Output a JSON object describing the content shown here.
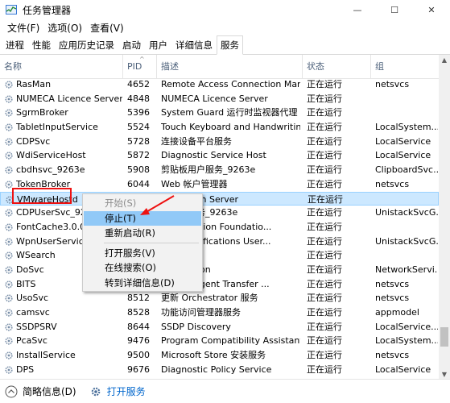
{
  "window": {
    "title": "任务管理器",
    "controls": [
      "—",
      "☐",
      "✕"
    ]
  },
  "menu": [
    "文件(F)",
    "选项(O)",
    "查看(V)"
  ],
  "tabs": [
    {
      "label": "进程",
      "active": false
    },
    {
      "label": "性能",
      "active": false
    },
    {
      "label": "应用历史记录",
      "active": false
    },
    {
      "label": "启动",
      "active": false
    },
    {
      "label": "用户",
      "active": false
    },
    {
      "label": "详细信息",
      "active": false
    },
    {
      "label": "服务",
      "active": true
    }
  ],
  "columns": {
    "name": "名称",
    "pid": "PID",
    "desc": "描述",
    "status": "状态",
    "group": "组"
  },
  "rows": [
    {
      "name": "RasMan",
      "pid": "4652",
      "desc": "Remote Access Connection Man...",
      "status": "正在运行",
      "group": "netsvcs"
    },
    {
      "name": "NUMECA Licence Server",
      "pid": "4848",
      "desc": "NUMECA Licence Server",
      "status": "正在运行",
      "group": ""
    },
    {
      "name": "SgrmBroker",
      "pid": "5396",
      "desc": "System Guard 运行时监视器代理",
      "status": "正在运行",
      "group": ""
    },
    {
      "name": "TabletInputService",
      "pid": "5524",
      "desc": "Touch Keyboard and Handwritin...",
      "status": "正在运行",
      "group": "LocalSystem..."
    },
    {
      "name": "CDPSvc",
      "pid": "5728",
      "desc": "连接设备平台服务",
      "status": "正在运行",
      "group": "LocalService"
    },
    {
      "name": "WdiServiceHost",
      "pid": "5872",
      "desc": "Diagnostic Service Host",
      "status": "正在运行",
      "group": "LocalService"
    },
    {
      "name": "cbdhsvc_9263e",
      "pid": "5908",
      "desc": "剪贴板用户服务_9263e",
      "status": "正在运行",
      "group": "ClipboardSvc..."
    },
    {
      "name": "TokenBroker",
      "pid": "6044",
      "desc": "Web 帐户管理器",
      "status": "正在运行",
      "group": "netsvcs"
    },
    {
      "name": "VMwareHostd",
      "pid": "",
      "desc": "orkstation Server",
      "status": "正在运行",
      "group": ""
    },
    {
      "name": "CDPUserSvc_926",
      "pid": "",
      "desc": "台用户服务_9263e",
      "status": "正在运行",
      "group": "UnistackSvcG..."
    },
    {
      "name": "FontCache3.0.0.0",
      "pid": "",
      "desc": "Presentation Foundatio...",
      "status": "正在运行",
      "group": ""
    },
    {
      "name": "WpnUserService",
      "pid": "",
      "desc": "Push Notifications User...",
      "status": "正在运行",
      "group": "UnistackSvcG..."
    },
    {
      "name": "WSearch",
      "pid": "",
      "desc": "",
      "status": "正在运行",
      "group": ""
    },
    {
      "name": "DoSvc",
      "pid": "",
      "desc": "ptimization",
      "status": "正在运行",
      "group": "NetworkServi..."
    },
    {
      "name": "BITS",
      "pid": "",
      "desc": "nd Intelligent Transfer ...",
      "status": "正在运行",
      "group": "netsvcs"
    },
    {
      "name": "UsoSvc",
      "pid": "8512",
      "desc": "更新 Orchestrator 服务",
      "status": "正在运行",
      "group": "netsvcs"
    },
    {
      "name": "camsvc",
      "pid": "8528",
      "desc": "功能访问管理器服务",
      "status": "正在运行",
      "group": "appmodel"
    },
    {
      "name": "SSDPSRV",
      "pid": "8644",
      "desc": "SSDP Discovery",
      "status": "正在运行",
      "group": "LocalService..."
    },
    {
      "name": "PcaSvc",
      "pid": "9476",
      "desc": "Program Compatibility Assistant ...",
      "status": "正在运行",
      "group": "LocalSystem..."
    },
    {
      "name": "InstallService",
      "pid": "9500",
      "desc": "Microsoft Store 安装服务",
      "status": "正在运行",
      "group": "netsvcs"
    },
    {
      "name": "DPS",
      "pid": "9676",
      "desc": "Diagnostic Policy Service",
      "status": "正在运行",
      "group": "LocalService"
    }
  ],
  "selected_row": "VMwareHostd",
  "context_menu": {
    "items": [
      {
        "label": "开始(S)",
        "disabled": true,
        "hover": false
      },
      {
        "label": "停止(T)",
        "disabled": false,
        "hover": true
      },
      {
        "label": "重新启动(R)",
        "disabled": false,
        "hover": false
      },
      {
        "label": "打开服务(V)",
        "disabled": false,
        "hover": false
      },
      {
        "label": "在线搜索(O)",
        "disabled": false,
        "hover": false
      },
      {
        "label": "转到详细信息(D)",
        "disabled": false,
        "hover": false
      }
    ]
  },
  "footer": {
    "summary_label": "简略信息(D)",
    "open_services_label": "打开服务"
  },
  "colors": {
    "selection_bg": "#cce8ff",
    "menu_hover": "#91c9f7",
    "highlight_red": "#ee1111",
    "link_blue": "#0066cc"
  }
}
